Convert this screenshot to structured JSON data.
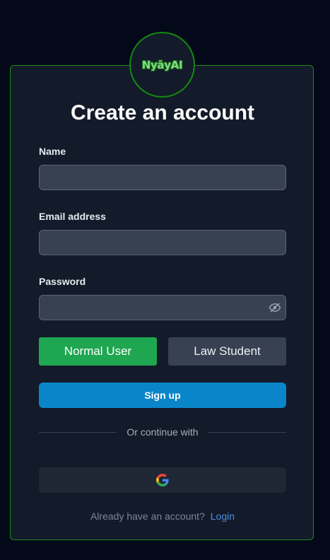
{
  "logo": {
    "text": "NyāyAI"
  },
  "title": "Create an account",
  "form": {
    "name_label": "Name",
    "name_value": "",
    "email_label": "Email address",
    "email_value": "",
    "password_label": "Password",
    "password_value": ""
  },
  "roles": {
    "normal_label": "Normal User",
    "law_label": "Law Student",
    "selected": "Normal User"
  },
  "signup_label": "Sign up",
  "divider_text": "Or continue with",
  "footer": {
    "prompt": "Already have an account?",
    "login_label": "Login"
  },
  "icons": {
    "password_toggle": "eye-off-icon",
    "google": "google-icon"
  },
  "colors": {
    "accent_green": "#1fa650",
    "signup_blue": "#0a85c9",
    "border_green": "#1f8a1f",
    "link_blue": "#4a8fe8"
  }
}
